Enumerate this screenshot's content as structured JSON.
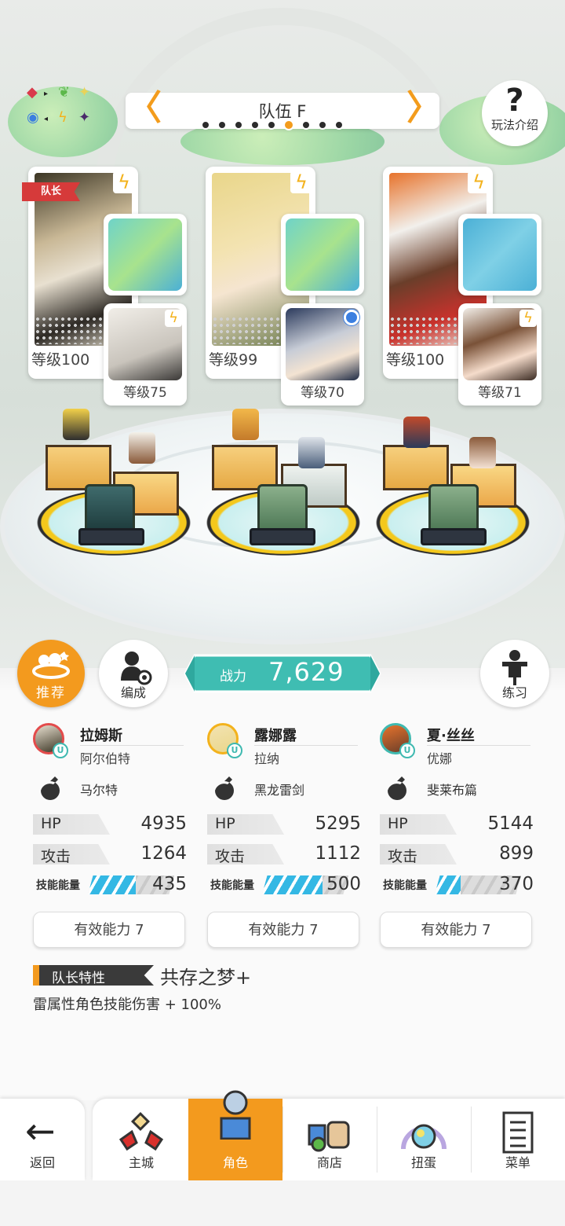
{
  "header": {
    "team_title": "队伍 F",
    "prev_arrow": "〈",
    "next_arrow": "〉",
    "page_count": 9,
    "active_page_index": 5,
    "help_label": "玩法介绍",
    "help_symbol": "?"
  },
  "cards": [
    {
      "leader_tag": "队长",
      "main_level": "等级100",
      "sub_level": "等级75"
    },
    {
      "leader_tag": "",
      "main_level": "等级99",
      "sub_level": "等级70"
    },
    {
      "leader_tag": "",
      "main_level": "等级100",
      "sub_level": "等级71"
    }
  ],
  "actions": {
    "recommend_label": "推荐",
    "formation_label": "编成",
    "practice_label": "练习"
  },
  "power": {
    "label": "战力",
    "value": "7,629"
  },
  "members": [
    {
      "name": "拉姆斯",
      "support": "阿尔伯特",
      "weapon": "马尔特",
      "hp_label": "HP",
      "hp": "4935",
      "atk_label": "攻击",
      "atk": "1264",
      "skill_label": "技能能量",
      "skill": "435",
      "skill_fill": 0.55,
      "effective": "有效能力 7"
    },
    {
      "name": "露娜露",
      "support": "拉纳",
      "weapon": "黑龙雷剑",
      "hp_label": "HP",
      "hp": "5295",
      "atk_label": "攻击",
      "atk": "1112",
      "skill_label": "技能能量",
      "skill": "500",
      "skill_fill": 0.7,
      "effective": "有效能力 7"
    },
    {
      "name": "夏·丝丝",
      "support": "优娜",
      "weapon": "斐莱布篇",
      "hp_label": "HP",
      "hp": "5144",
      "atk_label": "攻击",
      "atk": "899",
      "skill_label": "技能能量",
      "skill": "370",
      "skill_fill": 0.3,
      "effective": "有效能力 7"
    }
  ],
  "leader_trait": {
    "tag": "队长特性",
    "name": "共存之梦+",
    "description": "雷属性角色技能伤害 + 100%"
  },
  "nav": {
    "back_label": "返回",
    "tabs": [
      {
        "label": "主城",
        "icon": "town-icon"
      },
      {
        "label": "角色",
        "icon": "character-icon"
      },
      {
        "label": "商店",
        "icon": "shop-icon"
      },
      {
        "label": "扭蛋",
        "icon": "gacha-icon"
      },
      {
        "label": "菜单",
        "icon": "menu-icon"
      }
    ],
    "active_tab_index": 1
  },
  "colors": {
    "accent": "#f39a1e",
    "teal": "#3fbdb2",
    "skill_blue": "#34b8e4",
    "leader_red": "#d63a3a"
  }
}
